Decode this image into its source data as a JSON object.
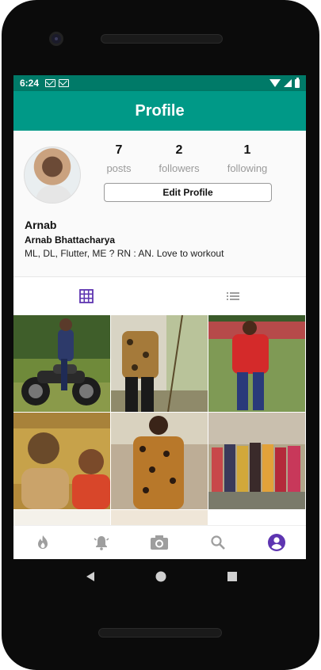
{
  "status_bar": {
    "time": "6:24",
    "icons": [
      "mail-icon",
      "mail-icon",
      "wifi-icon",
      "signal-icon",
      "battery-icon"
    ]
  },
  "app_bar": {
    "title": "Profile"
  },
  "profile": {
    "stats": [
      {
        "value": "7",
        "label": "posts"
      },
      {
        "value": "2",
        "label": "followers"
      },
      {
        "value": "1",
        "label": "following"
      }
    ],
    "edit_button": "Edit Profile",
    "username": "Arnab",
    "full_name": "Arnab Bhattacharya",
    "bio": "ML, DL, Flutter, ME ? RN : AN. Love to workout"
  },
  "tabs": [
    {
      "icon": "grid-icon",
      "active": true
    },
    {
      "icon": "list-icon",
      "active": false
    }
  ],
  "posts": [
    {
      "name": "post-motorcycle"
    },
    {
      "name": "post-printed-shirt-outdoor"
    },
    {
      "name": "post-red-shirt"
    },
    {
      "name": "post-couple-selfie"
    },
    {
      "name": "post-printed-shirt-portrait"
    },
    {
      "name": "post-group-photo"
    }
  ],
  "bottom_nav": [
    {
      "icon": "flame-icon",
      "active": false
    },
    {
      "icon": "bell-icon",
      "active": false
    },
    {
      "icon": "camera-icon",
      "active": false
    },
    {
      "icon": "search-icon",
      "active": false
    },
    {
      "icon": "account-icon",
      "active": true
    }
  ],
  "colors": {
    "primary": "#009987",
    "status_bar": "#007a68",
    "active_icon": "#5e35b1",
    "inactive_icon": "#9e9e9e"
  }
}
